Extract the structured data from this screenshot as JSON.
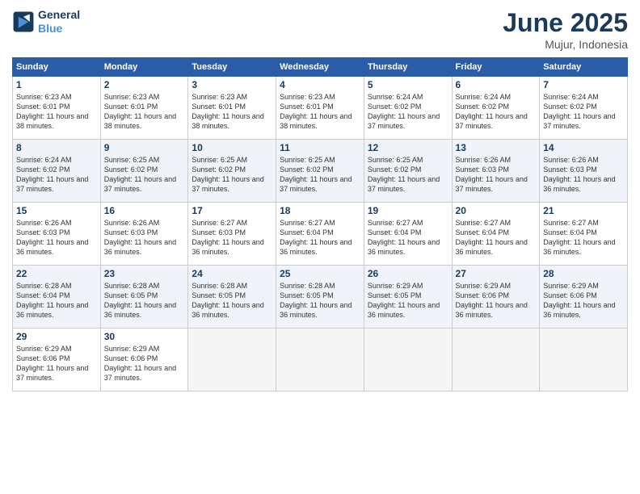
{
  "header": {
    "logo_line1": "General",
    "logo_line2": "Blue",
    "month": "June 2025",
    "location": "Mujur, Indonesia"
  },
  "weekdays": [
    "Sunday",
    "Monday",
    "Tuesday",
    "Wednesday",
    "Thursday",
    "Friday",
    "Saturday"
  ],
  "weeks": [
    [
      {
        "day": "1",
        "sunrise": "6:23 AM",
        "sunset": "6:01 PM",
        "daylight": "11 hours and 38 minutes."
      },
      {
        "day": "2",
        "sunrise": "6:23 AM",
        "sunset": "6:01 PM",
        "daylight": "11 hours and 38 minutes."
      },
      {
        "day": "3",
        "sunrise": "6:23 AM",
        "sunset": "6:01 PM",
        "daylight": "11 hours and 38 minutes."
      },
      {
        "day": "4",
        "sunrise": "6:23 AM",
        "sunset": "6:01 PM",
        "daylight": "11 hours and 38 minutes."
      },
      {
        "day": "5",
        "sunrise": "6:24 AM",
        "sunset": "6:02 PM",
        "daylight": "11 hours and 37 minutes."
      },
      {
        "day": "6",
        "sunrise": "6:24 AM",
        "sunset": "6:02 PM",
        "daylight": "11 hours and 37 minutes."
      },
      {
        "day": "7",
        "sunrise": "6:24 AM",
        "sunset": "6:02 PM",
        "daylight": "11 hours and 37 minutes."
      }
    ],
    [
      {
        "day": "8",
        "sunrise": "6:24 AM",
        "sunset": "6:02 PM",
        "daylight": "11 hours and 37 minutes."
      },
      {
        "day": "9",
        "sunrise": "6:25 AM",
        "sunset": "6:02 PM",
        "daylight": "11 hours and 37 minutes."
      },
      {
        "day": "10",
        "sunrise": "6:25 AM",
        "sunset": "6:02 PM",
        "daylight": "11 hours and 37 minutes."
      },
      {
        "day": "11",
        "sunrise": "6:25 AM",
        "sunset": "6:02 PM",
        "daylight": "11 hours and 37 minutes."
      },
      {
        "day": "12",
        "sunrise": "6:25 AM",
        "sunset": "6:02 PM",
        "daylight": "11 hours and 37 minutes."
      },
      {
        "day": "13",
        "sunrise": "6:26 AM",
        "sunset": "6:03 PM",
        "daylight": "11 hours and 37 minutes."
      },
      {
        "day": "14",
        "sunrise": "6:26 AM",
        "sunset": "6:03 PM",
        "daylight": "11 hours and 36 minutes."
      }
    ],
    [
      {
        "day": "15",
        "sunrise": "6:26 AM",
        "sunset": "6:03 PM",
        "daylight": "11 hours and 36 minutes."
      },
      {
        "day": "16",
        "sunrise": "6:26 AM",
        "sunset": "6:03 PM",
        "daylight": "11 hours and 36 minutes."
      },
      {
        "day": "17",
        "sunrise": "6:27 AM",
        "sunset": "6:03 PM",
        "daylight": "11 hours and 36 minutes."
      },
      {
        "day": "18",
        "sunrise": "6:27 AM",
        "sunset": "6:04 PM",
        "daylight": "11 hours and 36 minutes."
      },
      {
        "day": "19",
        "sunrise": "6:27 AM",
        "sunset": "6:04 PM",
        "daylight": "11 hours and 36 minutes."
      },
      {
        "day": "20",
        "sunrise": "6:27 AM",
        "sunset": "6:04 PM",
        "daylight": "11 hours and 36 minutes."
      },
      {
        "day": "21",
        "sunrise": "6:27 AM",
        "sunset": "6:04 PM",
        "daylight": "11 hours and 36 minutes."
      }
    ],
    [
      {
        "day": "22",
        "sunrise": "6:28 AM",
        "sunset": "6:04 PM",
        "daylight": "11 hours and 36 minutes."
      },
      {
        "day": "23",
        "sunrise": "6:28 AM",
        "sunset": "6:05 PM",
        "daylight": "11 hours and 36 minutes."
      },
      {
        "day": "24",
        "sunrise": "6:28 AM",
        "sunset": "6:05 PM",
        "daylight": "11 hours and 36 minutes."
      },
      {
        "day": "25",
        "sunrise": "6:28 AM",
        "sunset": "6:05 PM",
        "daylight": "11 hours and 36 minutes."
      },
      {
        "day": "26",
        "sunrise": "6:29 AM",
        "sunset": "6:05 PM",
        "daylight": "11 hours and 36 minutes."
      },
      {
        "day": "27",
        "sunrise": "6:29 AM",
        "sunset": "6:06 PM",
        "daylight": "11 hours and 36 minutes."
      },
      {
        "day": "28",
        "sunrise": "6:29 AM",
        "sunset": "6:06 PM",
        "daylight": "11 hours and 36 minutes."
      }
    ],
    [
      {
        "day": "29",
        "sunrise": "6:29 AM",
        "sunset": "6:06 PM",
        "daylight": "11 hours and 37 minutes."
      },
      {
        "day": "30",
        "sunrise": "6:29 AM",
        "sunset": "6:06 PM",
        "daylight": "11 hours and 37 minutes."
      },
      null,
      null,
      null,
      null,
      null
    ]
  ]
}
